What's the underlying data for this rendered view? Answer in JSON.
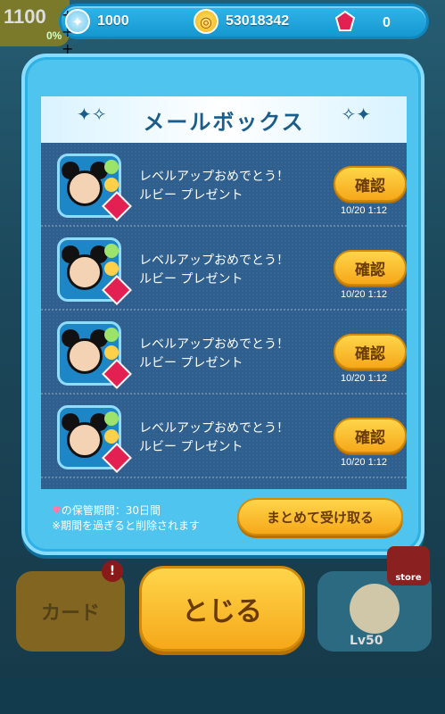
{
  "top_left": {
    "score": "1100",
    "pct": "0%"
  },
  "currency": {
    "hearts": "1000",
    "coins": "53018342",
    "rubies": "0"
  },
  "modal": {
    "title": "メールボックス",
    "items": [
      {
        "line1": "レベルアップおめでとう！",
        "line2": "ルビー プレゼント",
        "button": "確認",
        "time": "10/20  1:12"
      },
      {
        "line1": "レベルアップおめでとう！",
        "line2": "ルビー プレゼント",
        "button": "確認",
        "time": "10/20  1:12"
      },
      {
        "line1": "レベルアップおめでとう！",
        "line2": "ルビー プレゼント",
        "button": "確認",
        "time": "10/20  1:12"
      },
      {
        "line1": "レベルアップおめでとう！",
        "line2": "ルビー プレゼント",
        "button": "確認",
        "time": "10/20  1:12"
      }
    ],
    "retention_note": "の保管期間：30日間",
    "delete_note": "※期間を過ぎると削除されます",
    "receive_all": "まとめて受け取る"
  },
  "bottom": {
    "card_label": "カード",
    "badge": "!",
    "close_label": "とじる",
    "tsum_level": "Lv50",
    "store_label": "store"
  },
  "colors": {
    "accent_blue": "#4fc4ef",
    "button_yellow": "#f6a81a",
    "list_bg": "#2f5f8e",
    "ruby": "#e32052"
  }
}
